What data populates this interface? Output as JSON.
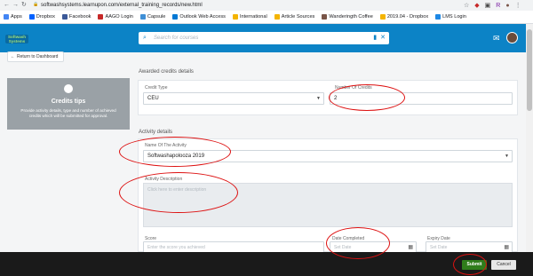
{
  "browser": {
    "url": "softwashsystems.learnupon.com/external_training_records/new.html",
    "bookmarks": [
      {
        "label": "Apps",
        "color": "#4285f4"
      },
      {
        "label": "Dropbox",
        "color": "#0061ff"
      },
      {
        "label": "Facebook",
        "color": "#3b5998"
      },
      {
        "label": "AAGO Login",
        "color": "#c62828"
      },
      {
        "label": "Capsule",
        "color": "#3f8fd6"
      },
      {
        "label": "Outlook Web Access",
        "color": "#0078d4"
      },
      {
        "label": "International",
        "color": "#f4b400"
      },
      {
        "label": "Article Sources",
        "color": "#f4b400"
      },
      {
        "label": "Wanderingth Coffee",
        "color": "#795548"
      },
      {
        "label": "2019.04 - Dropbox",
        "color": "#f4b400"
      },
      {
        "label": "LMS Login",
        "color": "#1e88e5"
      }
    ]
  },
  "header": {
    "search_placeholder": "Search for courses"
  },
  "return_button": "Return to Dashboard",
  "tips": {
    "title": "Credits tips",
    "text": "Provide activity details, type and number of achieved credits which will be submitted for approval."
  },
  "credits": {
    "section_title": "Awarded credits details",
    "credit_type_label": "Credit Type",
    "credit_type_value": "CEU",
    "number_label": "Number Of Credits",
    "number_value": "2"
  },
  "activity": {
    "section_title": "Activity details",
    "name_label": "Name Of The Activity",
    "name_value": "Softwashapolooza 2019",
    "description_label": "Activity Description",
    "description_placeholder": "Click here to enter description",
    "score_label": "Score",
    "score_placeholder": "Enter the score you achieved",
    "date_label": "Date Completed",
    "date_placeholder": "Set Date",
    "expiry_label": "Expiry Date",
    "expiry_placeholder": "Set Date"
  },
  "footer": {
    "submit_label": "Submit",
    "cancel_label": "Cancel"
  },
  "colors": {
    "brand": "#0c83c6",
    "submit": "#2f7d1b",
    "annotation": "#dd1111"
  }
}
